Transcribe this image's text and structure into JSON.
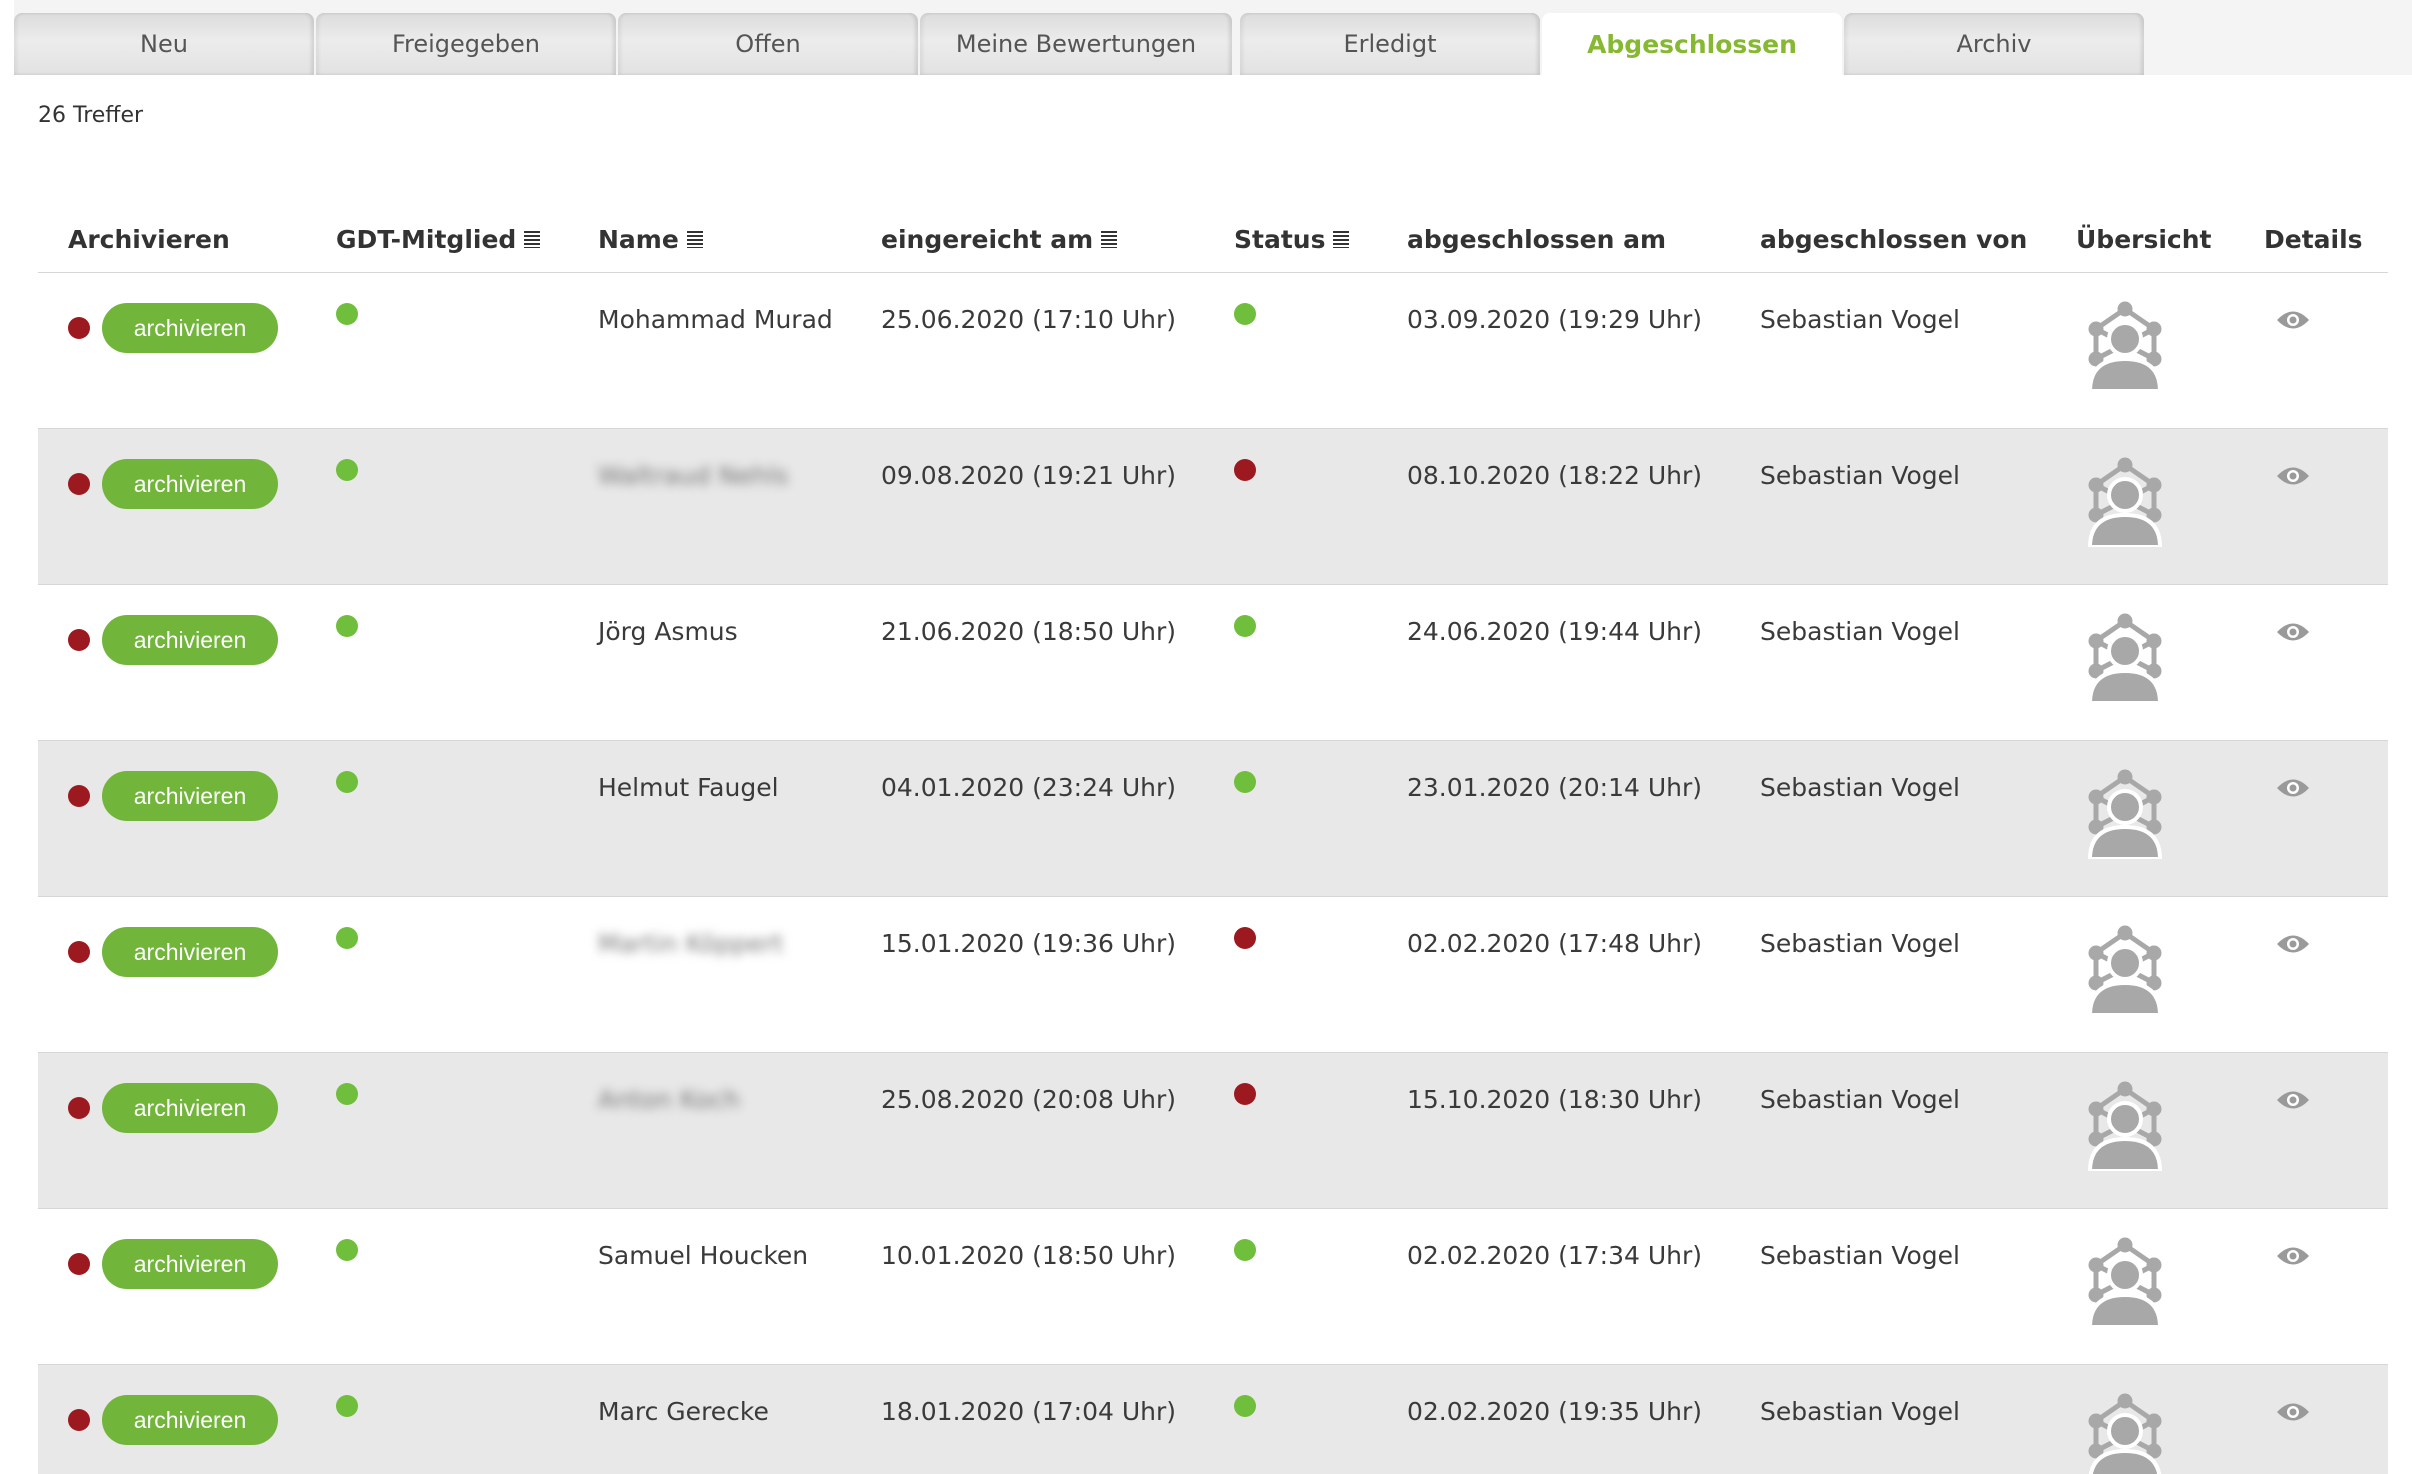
{
  "tabs": [
    {
      "label": "Neu",
      "active": false
    },
    {
      "label": "Freigegeben",
      "active": false
    },
    {
      "label": "Offen",
      "active": false
    },
    {
      "label": "Meine Bewertungen",
      "active": false
    },
    {
      "label": "Erledigt",
      "active": false
    },
    {
      "label": "Abgeschlossen",
      "active": true
    },
    {
      "label": "Archiv",
      "active": false
    }
  ],
  "result_count": "26 Treffer",
  "columns": {
    "archivieren": "Archivieren",
    "gdt": "GDT-Mitglied",
    "name": "Name",
    "eingereicht": "eingereicht am",
    "status": "Status",
    "abgeschlossen_am": "abgeschlossen am",
    "abgeschlossen_von": "abgeschlossen von",
    "uebersicht": "Übersicht",
    "details": "Details"
  },
  "button_label": "archivieren",
  "colors": {
    "accent": "#86b832",
    "button": "#71b53a",
    "green": "#6fbe3c",
    "red": "#9c1a1f"
  },
  "icons": {
    "overview": "user-network-icon",
    "details": "eye-icon",
    "sort": "list-sort-icon"
  },
  "rows": [
    {
      "name": "Mohammad Murad",
      "blurred": false,
      "gdt": "green",
      "submitted": "25.06.2020 (17:10 Uhr)",
      "status": "green",
      "closed": "03.09.2020 (19:29 Uhr)",
      "closed_by": "Sebastian Vogel"
    },
    {
      "name": "Waltraud Nehls",
      "blurred": true,
      "gdt": "green",
      "submitted": "09.08.2020 (19:21 Uhr)",
      "status": "red",
      "closed": "08.10.2020 (18:22 Uhr)",
      "closed_by": "Sebastian Vogel"
    },
    {
      "name": "Jörg Asmus",
      "blurred": false,
      "gdt": "green",
      "submitted": "21.06.2020 (18:50 Uhr)",
      "status": "green",
      "closed": "24.06.2020 (19:44 Uhr)",
      "closed_by": "Sebastian Vogel"
    },
    {
      "name": "Helmut Faugel",
      "blurred": false,
      "gdt": "green",
      "submitted": "04.01.2020 (23:24 Uhr)",
      "status": "green",
      "closed": "23.01.2020 (20:14 Uhr)",
      "closed_by": "Sebastian Vogel"
    },
    {
      "name": "Martin Köppert",
      "blurred": true,
      "gdt": "green",
      "submitted": "15.01.2020 (19:36 Uhr)",
      "status": "red",
      "closed": "02.02.2020 (17:48 Uhr)",
      "closed_by": "Sebastian Vogel"
    },
    {
      "name": "Anton Koch",
      "blurred": true,
      "gdt": "green",
      "submitted": "25.08.2020 (20:08 Uhr)",
      "status": "red",
      "closed": "15.10.2020 (18:30 Uhr)",
      "closed_by": "Sebastian Vogel"
    },
    {
      "name": "Samuel Houcken",
      "blurred": false,
      "gdt": "green",
      "submitted": "10.01.2020 (18:50 Uhr)",
      "status": "green",
      "closed": "02.02.2020 (17:34 Uhr)",
      "closed_by": "Sebastian Vogel"
    },
    {
      "name": "Marc Gerecke",
      "blurred": false,
      "gdt": "green",
      "submitted": "18.01.2020 (17:04 Uhr)",
      "status": "green",
      "closed": "02.02.2020 (19:35 Uhr)",
      "closed_by": "Sebastian Vogel"
    }
  ]
}
